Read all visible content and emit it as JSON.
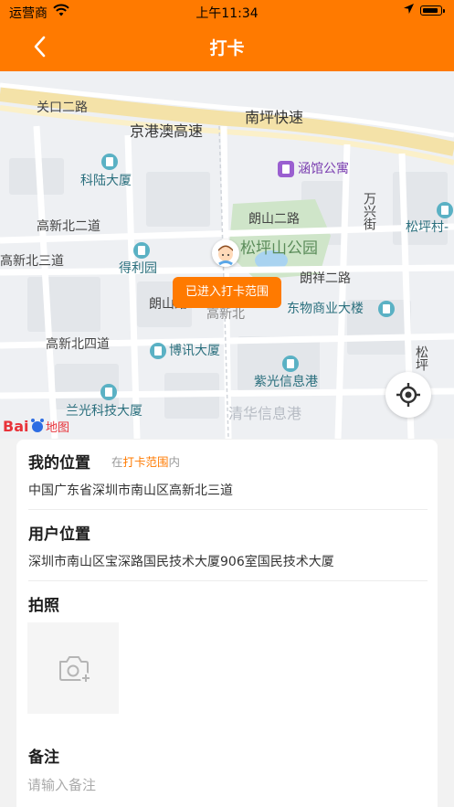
{
  "status_bar": {
    "carrier": "运营商",
    "time": "上午11:34"
  },
  "nav": {
    "title": "打卡"
  },
  "map": {
    "labels": {
      "guankou": "关口二路",
      "nanping": "南坪快速",
      "jinggangao": "京港澳高速",
      "hanguan": "涵馆公寓",
      "kelu": "科陆大厦",
      "wanxing": "万兴街",
      "gaoxin2": "高新北二道",
      "langshan2": "朗山二路",
      "songping_park": "松坪山公园",
      "songping_village": "松坪村-",
      "gaoxin3": "高新北三道",
      "deli": "得利园",
      "langxiang2": "朗祥二路",
      "langshan_cut": "朗山路",
      "gaoxinbei": "高新北",
      "dongwu": "东物商业大楼",
      "gaoxin4": "高新北四道",
      "boxun": "博讯大厦",
      "songping_vert": "松坪",
      "ziguang": "紫光信息港",
      "lanzhuang": "兰光科技大厦",
      "qinghua": "清华信息港"
    },
    "tip": "已进入打卡范围",
    "logo_text": "Bai地图"
  },
  "my_location": {
    "title": "我的位置",
    "hint_prefix": "在",
    "hint_highlight": "打卡范围",
    "hint_suffix": "内",
    "address": "中国广东省深圳市南山区高新北三道"
  },
  "user_location": {
    "title": "用户位置",
    "address": "深圳市南山区宝深路国民技术大厦906室国民技术大厦"
  },
  "photo": {
    "title": "拍照"
  },
  "remark": {
    "title": "备注",
    "placeholder": "请输入备注"
  },
  "colors": {
    "accent": "#ff7a00",
    "poi": "#5ab1c4",
    "poi_purple": "#9a5fd0",
    "park": "#cfe5c9"
  },
  "icons": {
    "back": "chevron-left-icon",
    "wifi": "wifi-icon",
    "location_arrow": "location-arrow-icon",
    "battery": "battery-icon",
    "locate": "crosshair-icon",
    "camera": "camera-plus-icon",
    "user_pin": "user-avatar-icon"
  }
}
